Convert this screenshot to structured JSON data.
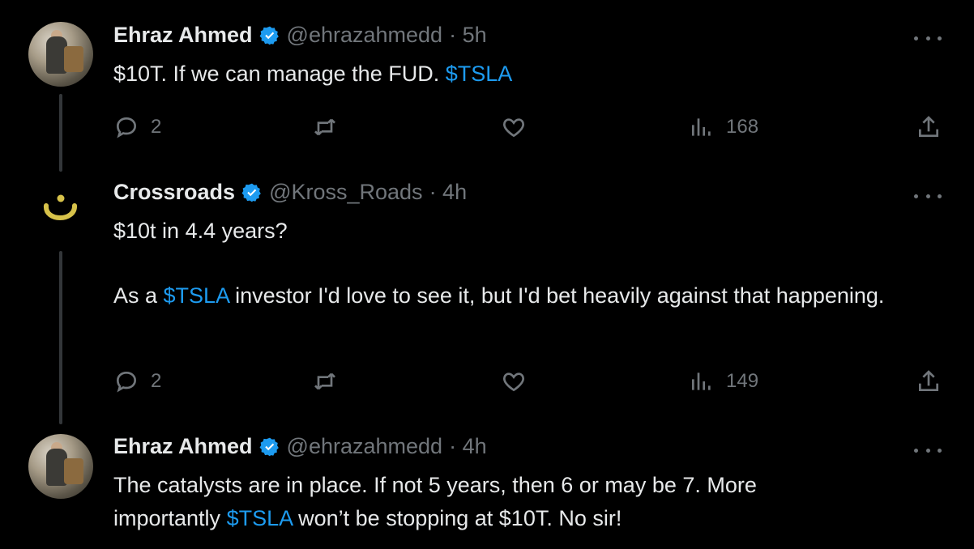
{
  "tweets": [
    {
      "author": "Ehraz Ahmed",
      "handle": "@ehrazahmedd",
      "time": "· 5h",
      "avatar_icon": "person-photo-avatar",
      "text": [
        {
          "t": "$10T. If we can manage the FUD. ",
          "cash": false
        },
        {
          "t": "$TSLA",
          "cash": true
        }
      ],
      "replies": "2",
      "views": "168"
    },
    {
      "author": "Crossroads",
      "handle": "@Kross_Roads",
      "time": "· 4h",
      "avatar_icon": "arabic-nun-logo-avatar",
      "text_line1": "$10t in 4.4 years?",
      "text_para2": [
        {
          "t": "As a ",
          "cash": false
        },
        {
          "t": "$TSLA",
          "cash": true
        },
        {
          "t": " investor I'd love to see it, but I'd bet heavily against that happening.",
          "cash": false
        }
      ],
      "replies": "2",
      "views": "149"
    },
    {
      "author": "Ehraz Ahmed",
      "handle": "@ehrazahmedd",
      "time": "· 4h",
      "avatar_icon": "person-photo-avatar",
      "text": [
        {
          "t": "The catalysts are in place. If not 5 years, then 6 or may be 7. More importantly ",
          "cash": false
        },
        {
          "t": "$TSLA",
          "cash": true
        },
        {
          "t": " won’t be stopping at $10T. No sir!",
          "cash": false
        }
      ]
    }
  ],
  "colors": {
    "background": "#000000",
    "text": "#e7e9ea",
    "muted": "#71767b",
    "accent": "#1d9bf0"
  }
}
